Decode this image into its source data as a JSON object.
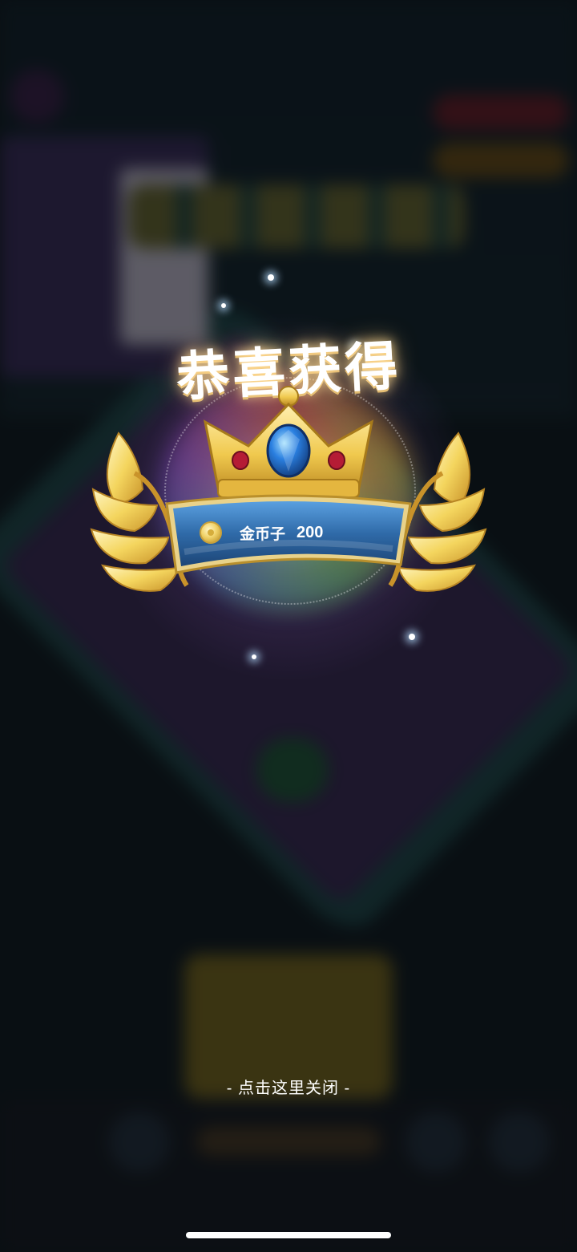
{
  "popup": {
    "title": "恭喜获得",
    "reward": {
      "icon": "coin-icon",
      "name": "金币子",
      "amount": "200"
    },
    "close_hint": "- 点击这里关闭 -"
  },
  "colors": {
    "banner_blue": "#2f6aa8",
    "gold": "#f2cf5a",
    "gem_blue": "#2a7fe0",
    "gem_red": "#b51c35"
  }
}
